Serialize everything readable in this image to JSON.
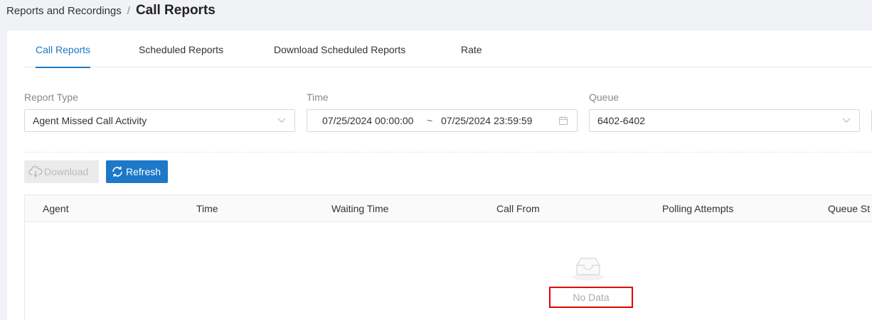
{
  "breadcrumb": {
    "parent": "Reports and Recordings",
    "separator": "/",
    "current": "Call Reports"
  },
  "tabs": [
    {
      "label": "Call Reports",
      "active": true
    },
    {
      "label": "Scheduled Reports",
      "active": false
    },
    {
      "label": "Download Scheduled Reports",
      "active": false
    },
    {
      "label": "Rate",
      "active": false
    }
  ],
  "filters": {
    "report_type": {
      "label": "Report Type",
      "value": "Agent Missed Call Activity",
      "icon": "chevron-down-icon"
    },
    "time": {
      "label": "Time",
      "start": "07/25/2024 00:00:00",
      "separator": "~",
      "end": "07/25/2024 23:59:59",
      "icon": "calendar-icon"
    },
    "queue": {
      "label": "Queue",
      "value": "6402-6402",
      "icon": "chevron-down-icon"
    }
  },
  "actions": {
    "download_label": "Download",
    "download_icon": "cloud-download-icon",
    "refresh_label": "Refresh",
    "refresh_icon": "refresh-icon"
  },
  "table": {
    "columns": [
      "Agent",
      "Time",
      "Waiting Time",
      "Call From",
      "Polling Attempts",
      "Queue St"
    ],
    "rows": [],
    "empty_text": "No Data",
    "empty_icon": "empty-inbox-icon"
  },
  "colors": {
    "accent": "#1e78c8",
    "highlight_border": "#e00000",
    "page_background": "#f0f2f5"
  }
}
